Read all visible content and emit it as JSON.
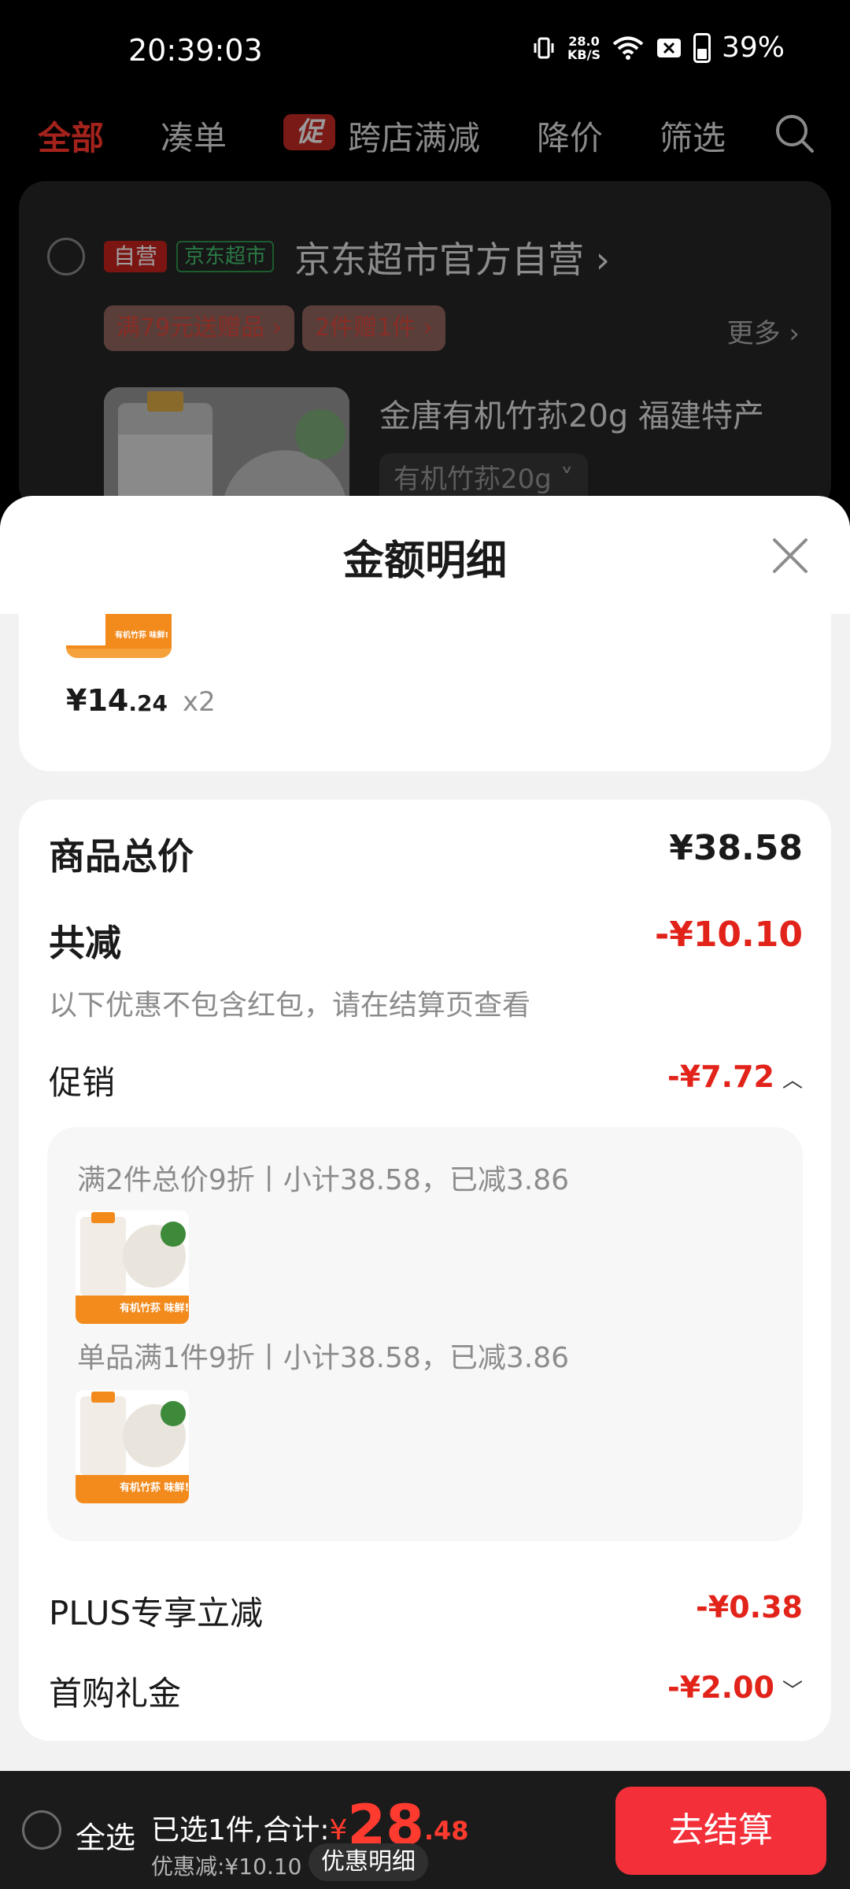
{
  "status_bar": {
    "time": "20:39:03",
    "net_speed_value": "28.0",
    "net_speed_unit": "KB/S",
    "battery": "39%",
    "icons": [
      "vibrate-icon",
      "wifi-icon",
      "sim-off-icon",
      "battery-icon"
    ]
  },
  "tabs": [
    {
      "label": "全部",
      "active": true
    },
    {
      "label": "凑单"
    },
    {
      "label": "跨店满减",
      "tag": "促"
    },
    {
      "label": "降价"
    },
    {
      "label": "筛选"
    }
  ],
  "store": {
    "badge_self": "自营",
    "badge_jd": "京东超市",
    "name": "京东超市官方自营",
    "promos": [
      "满79元送赠品",
      "2件赠1件"
    ],
    "more": "更多",
    "product_title": "金唐有机竹荪20g 福建特产",
    "variant": "有机竹荪20g"
  },
  "sheet": {
    "title": "金额明细",
    "item": {
      "price_int": "¥14",
      "price_dec": ".24",
      "qty": "x2"
    },
    "total_label": "商品总价",
    "total_value": "¥38.58",
    "reduce_label": "共减",
    "reduce_value": "-¥10.10",
    "reduce_note": "以下优惠不包含红包，请在结算页查看",
    "promo_label": "促销",
    "promo_value": "-¥7.72",
    "promo_lines": [
      "满2件总价9折丨小计38.58，已减3.86",
      "单品满1件9折丨小计38.58，已减3.86"
    ],
    "thumb_text": "有机竹荪 味鲜!",
    "plus_label": "PLUS专享立减",
    "plus_value": "-¥0.38",
    "first_label": "首购礼金",
    "first_value": "-¥2.00"
  },
  "bottom": {
    "select_all": "全选",
    "selected_prefix": "已选1件,合计:",
    "currency": "¥",
    "total_int": "28",
    "total_dec": ".48",
    "discount": "优惠减:¥10.10",
    "detail_button": "优惠明细",
    "checkout": "去结算"
  },
  "colors": {
    "accent": "#e2231a",
    "checkout": "#f3303a"
  }
}
